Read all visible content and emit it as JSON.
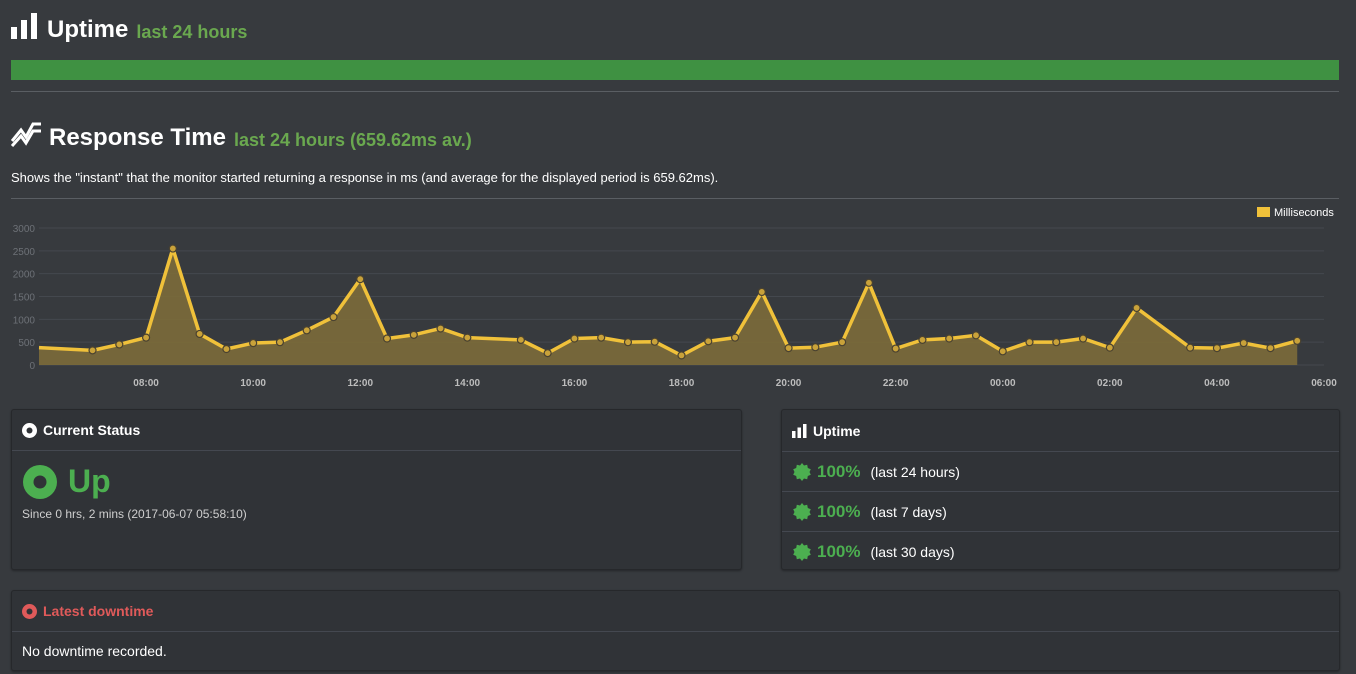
{
  "uptime_section": {
    "title": "Uptime",
    "subtitle": "last 24 hours",
    "bar_color": "#3f9142",
    "uptime_fraction": 1.0
  },
  "response_section": {
    "title": "Response Time",
    "subtitle": "last 24 hours (659.62ms av.)",
    "description": "Shows the \"instant\" that the monitor started returning a response in ms (and average for the displayed period is 659.62ms)."
  },
  "chart_data": {
    "type": "area",
    "legend": "Milliseconds",
    "legend_position": "top-right",
    "line_color": "#f0c13a",
    "fill_color": "#7c6c3a",
    "grid": true,
    "ylim": [
      0,
      3000
    ],
    "yticks": [
      "0",
      "500",
      "1000",
      "1500",
      "2000",
      "2500",
      "3000"
    ],
    "xlim_hours": [
      6.0,
      30.0
    ],
    "xticks": [
      {
        "hour": 8,
        "label": "08:00"
      },
      {
        "hour": 10,
        "label": "10:00"
      },
      {
        "hour": 12,
        "label": "12:00"
      },
      {
        "hour": 14,
        "label": "14:00"
      },
      {
        "hour": 16,
        "label": "16:00"
      },
      {
        "hour": 18,
        "label": "18:00"
      },
      {
        "hour": 20,
        "label": "20:00"
      },
      {
        "hour": 22,
        "label": "22:00"
      },
      {
        "hour": 24,
        "label": "00:00"
      },
      {
        "hour": 26,
        "label": "02:00"
      },
      {
        "hour": 28,
        "label": "04:00"
      },
      {
        "hour": 30,
        "label": "06:00"
      }
    ],
    "start_point": {
      "x": 6.0,
      "y": 380
    },
    "points": [
      {
        "x": 7.0,
        "y": 320
      },
      {
        "x": 7.5,
        "y": 450
      },
      {
        "x": 8.0,
        "y": 600
      },
      {
        "x": 8.5,
        "y": 2550
      },
      {
        "x": 9.0,
        "y": 680
      },
      {
        "x": 9.5,
        "y": 350
      },
      {
        "x": 10.0,
        "y": 480
      },
      {
        "x": 10.5,
        "y": 500
      },
      {
        "x": 11.0,
        "y": 760
      },
      {
        "x": 11.5,
        "y": 1050
      },
      {
        "x": 12.0,
        "y": 1880
      },
      {
        "x": 12.5,
        "y": 580
      },
      {
        "x": 13.0,
        "y": 660
      },
      {
        "x": 13.5,
        "y": 800
      },
      {
        "x": 14.0,
        "y": 600
      },
      {
        "x": 15.0,
        "y": 550
      },
      {
        "x": 15.5,
        "y": 260
      },
      {
        "x": 16.0,
        "y": 580
      },
      {
        "x": 16.5,
        "y": 600
      },
      {
        "x": 17.0,
        "y": 500
      },
      {
        "x": 17.5,
        "y": 510
      },
      {
        "x": 18.0,
        "y": 210
      },
      {
        "x": 18.5,
        "y": 520
      },
      {
        "x": 19.0,
        "y": 600
      },
      {
        "x": 19.5,
        "y": 1600
      },
      {
        "x": 20.0,
        "y": 370
      },
      {
        "x": 20.5,
        "y": 390
      },
      {
        "x": 21.0,
        "y": 500
      },
      {
        "x": 21.5,
        "y": 1800
      },
      {
        "x": 22.0,
        "y": 360
      },
      {
        "x": 22.5,
        "y": 550
      },
      {
        "x": 23.0,
        "y": 580
      },
      {
        "x": 23.5,
        "y": 650
      },
      {
        "x": 24.0,
        "y": 300
      },
      {
        "x": 24.5,
        "y": 500
      },
      {
        "x": 25.0,
        "y": 500
      },
      {
        "x": 25.5,
        "y": 580
      },
      {
        "x": 26.0,
        "y": 380
      },
      {
        "x": 26.5,
        "y": 1250
      },
      {
        "x": 27.5,
        "y": 380
      },
      {
        "x": 28.0,
        "y": 370
      },
      {
        "x": 28.5,
        "y": 480
      },
      {
        "x": 29.0,
        "y": 370
      },
      {
        "x": 29.5,
        "y": 530
      }
    ]
  },
  "current_status": {
    "heading": "Current Status",
    "status": "Up",
    "since": "Since 0 hrs, 2 mins (2017-06-07 05:58:10)",
    "status_color": "#4caf50"
  },
  "uptime_panel": {
    "heading": "Uptime",
    "rows": [
      {
        "percent": "100%",
        "period": "(last 24 hours)"
      },
      {
        "percent": "100%",
        "period": "(last 7 days)"
      },
      {
        "percent": "100%",
        "period": "(last 30 days)"
      }
    ]
  },
  "downtime": {
    "heading": "Latest downtime",
    "text": "No downtime recorded.",
    "heading_color": "#e05a5a"
  }
}
